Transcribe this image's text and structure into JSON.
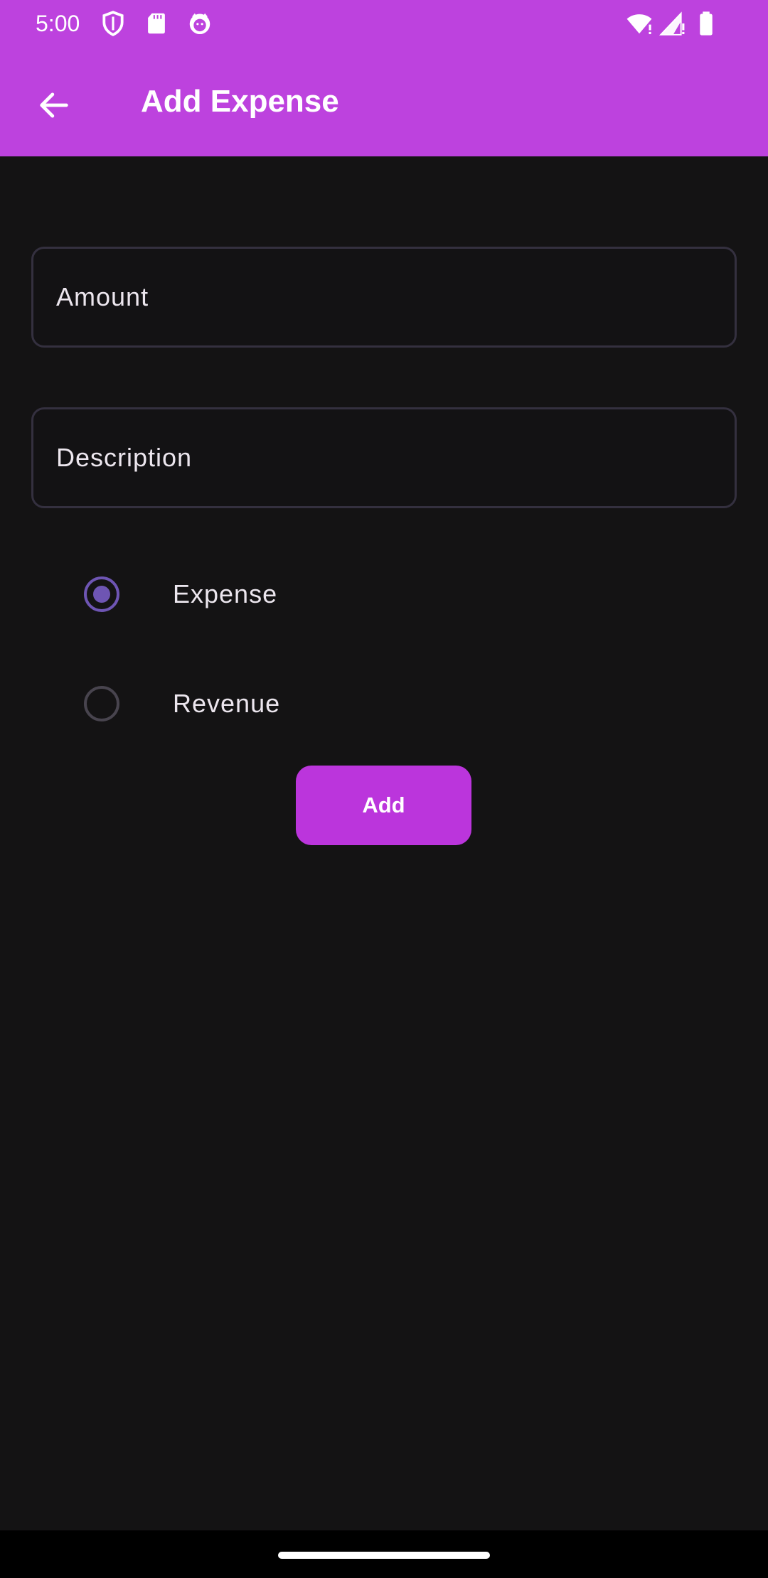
{
  "status_bar": {
    "time": "5:00",
    "icons": [
      "shield-icon",
      "sd-card-icon",
      "cat-face-icon",
      "wifi-icon",
      "signal-icon",
      "battery-icon"
    ]
  },
  "app_bar": {
    "title": "Add Expense",
    "back_icon": "arrow-back-icon"
  },
  "form": {
    "amount": {
      "label": "Amount",
      "value": ""
    },
    "description": {
      "label": "Description",
      "value": ""
    },
    "type_options": [
      {
        "label": "Expense",
        "selected": true
      },
      {
        "label": "Revenue",
        "selected": false
      }
    ],
    "submit_label": "Add"
  },
  "colors": {
    "primary": "#BD42DE",
    "background": "#141314",
    "radio_selected": "#6E55B3",
    "field_border": "#34303F"
  }
}
